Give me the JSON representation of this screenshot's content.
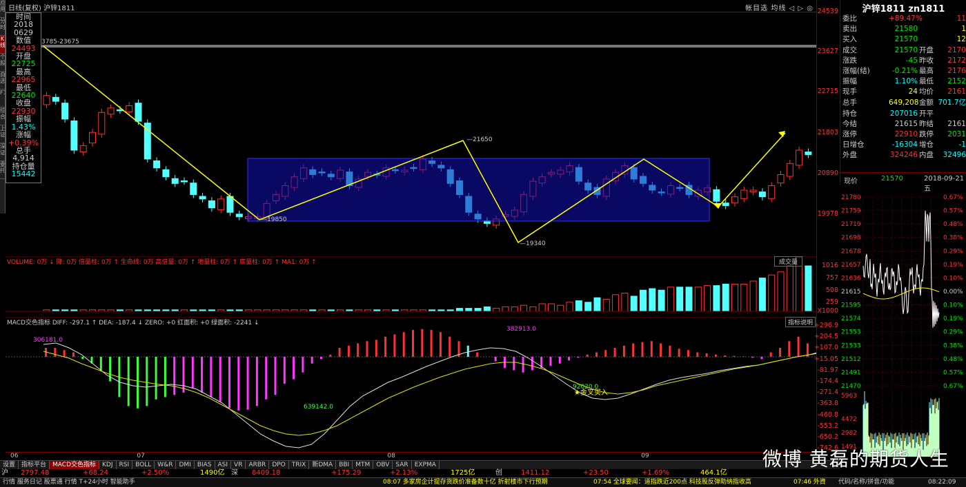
{
  "window": {
    "title_left": "日线(复权)  沪锌1811",
    "title_right": "帐目选 均线 ◁ ▷ ◎"
  },
  "left_tabs": [
    "应用",
    "分时",
    "K线",
    "个股",
    "自选",
    "F10",
    "综合",
    "上证",
    "深证",
    "委托"
  ],
  "info": {
    "time_label": "时间",
    "year": "2018",
    "date": "0629",
    "value_label": "数值",
    "value": "24493",
    "open_label": "开盘",
    "open": "22725",
    "high_label": "最高",
    "high": "22965",
    "low_label": "最低",
    "low": "22640",
    "close_label": "收盘",
    "close": "22930",
    "amp_label": "振幅",
    "amp": "1.43%",
    "chg_label": "涨幅",
    "chg": "+0.39%",
    "vol_label": "总手",
    "vol": "4,914",
    "oi_label": "持仓量",
    "oi": "15442"
  },
  "annotations": {
    "top_range": "3785-23675",
    "p_21650": "21650",
    "p_19850": "19850",
    "p_19340": "19340",
    "macd_306181": "306181.0",
    "macd_382913": "382913.0",
    "macd_639142": "639142.0",
    "macd_92020": "92020.0",
    "golden_cross": "★金叉买入"
  },
  "price_axis": [
    "24539",
    "23627",
    "22715",
    "21803",
    "20890",
    "19978"
  ],
  "vol_legend": {
    "text": "VOLUME: 0万 ↓ 降: 0万 倍量柱: 0万 ↑ 生命线: 0万 高倍量: 0万 ↑ 地量柱: 0万 ↑ 底量柱: 0万 ↑ MA1: 0万 ↑",
    "button": "成交量"
  },
  "vol_axis": [
    "1016",
    "757",
    "508",
    "259",
    "X1000"
  ],
  "macd_legend": {
    "text": "MACD交色指标  DIFF: -297.1 ↑ DEA: -187.4 ↓ ZERO: +0 红面积: +0 绿面积: -2241 ↓",
    "button": "指标说明"
  },
  "macd_axis": [
    "+296.9",
    "+204.5",
    "+107.0",
    "+15.05",
    "-81.97",
    "-174.4",
    "-271.4",
    "-363.8",
    "-460.8",
    "-553.2",
    "-650.2",
    "-742.6"
  ],
  "x_axis": [
    {
      "label": "06",
      "pos": 0.006
    },
    {
      "label": "07",
      "pos": 0.162
    },
    {
      "label": "08",
      "pos": 0.471
    },
    {
      "label": "09",
      "pos": 0.784
    }
  ],
  "bottom_tabs": [
    "设置",
    "指标平台",
    "MACD交色指标",
    "KDJ",
    "RSI",
    "BOLL",
    "W&R",
    "DMI",
    "BIAS",
    "ASI",
    "VR",
    "ARBR",
    "DPO",
    "TRIX",
    "新DMA",
    "BBI",
    "MTM",
    "OBV",
    "SAR",
    "EXPMA"
  ],
  "ticker": [
    {
      "t": "沪",
      "c": "#ccc"
    },
    {
      "t": "2797.48",
      "c": "#ff3232"
    },
    {
      "t": "+68.24",
      "c": "#ff3232"
    },
    {
      "t": "+2.50%",
      "c": "#ff3232"
    },
    {
      "t": "1490亿",
      "c": "#ffff00"
    },
    {
      "t": "深",
      "c": "#ccc"
    },
    {
      "t": "8409.18",
      "c": "#ff3232"
    },
    {
      "t": "+175.29",
      "c": "#ff3232"
    },
    {
      "t": "+2.13%",
      "c": "#ff3232"
    },
    {
      "t": "1725亿",
      "c": "#ffff00"
    },
    {
      "t": "创",
      "c": "#ccc"
    },
    {
      "t": "1411.12",
      "c": "#ff3232"
    },
    {
      "t": "+23.50",
      "c": "#ff3232"
    },
    {
      "t": "+1.69%",
      "c": "#ff3232"
    },
    {
      "t": "464.1亿",
      "c": "#ffff00"
    }
  ],
  "status_bar": {
    "left": "行情  服务日记  股票通  行情  T+24小时  智能助手",
    "news1": "08:07 多家房企计提存货跌价准备数十亿 折射楼市下行预期",
    "news2": "07:54 全球要闻：道指跌近200点 科技股反弹助纳指收高",
    "news3": "07:46 外資",
    "right": "代码/名称/拼音/功能",
    "clock": "08:22:09"
  },
  "panel": {
    "title": "沪锌1811 zn1811",
    "rows": [
      {
        "l": "委比",
        "v": "+89.47%",
        "vc": "#ff3232",
        "l2": "",
        "v2": "11",
        "v2c": "#ff3232"
      },
      {
        "l": "卖出",
        "v": "21580",
        "vc": "#00e600",
        "l2": "",
        "v2": "1",
        "v2c": "#ffff00"
      },
      {
        "l": "买入",
        "v": "21570",
        "vc": "#00e600",
        "l2": "",
        "v2": "12",
        "v2c": "#ffff00"
      },
      {
        "l": "成交",
        "v": "21570",
        "vc": "#00e600",
        "l2": "开盘",
        "v2": "2170",
        "v2c": "#ff3232"
      },
      {
        "l": "涨跌",
        "v": "-45",
        "vc": "#00e600",
        "l2": "昨收",
        "v2": "2172",
        "v2c": "#ff3232"
      },
      {
        "l": "涨幅(结)",
        "v": "-0.21%",
        "vc": "#00e600",
        "l2": "最高",
        "v2": "2176",
        "v2c": "#ff3232"
      },
      {
        "l": "振幅",
        "v": "1.10%",
        "vc": "#00ffff",
        "l2": "最低",
        "v2": "2152",
        "v2c": "#00e600"
      },
      {
        "l": "现手",
        "v": "24",
        "vc": "#ffff00",
        "l2": "均价",
        "v2": "2161",
        "v2c": "#ff3232"
      },
      {
        "l": "总手",
        "v": "649,208",
        "vc": "#ffff00",
        "l2": "金额",
        "v2": "701.7亿",
        "v2c": "#00ffff"
      },
      {
        "l": "持仓",
        "v": "207016",
        "vc": "#00ffff",
        "l2": "开平",
        "v2": "",
        "v2c": "#ccc"
      },
      {
        "l": "今结",
        "v": "21615",
        "vc": "#ccc",
        "l2": "昨结",
        "v2": "2161",
        "v2c": "#ccc"
      },
      {
        "l": "涨停",
        "v": "22910",
        "vc": "#ff3232",
        "l2": "跌停",
        "v2": "2031",
        "v2c": "#00e600"
      },
      {
        "l": "日增仓",
        "v": "-16304",
        "vc": "#00ffff",
        "l2": "增仓",
        "v2": "-1",
        "v2c": "#00ffff"
      },
      {
        "l": "外盘",
        "v": "324246",
        "vc": "#ff3232",
        "l2": "内盘",
        "v2": "32496",
        "v2c": "#00ffff"
      }
    ]
  },
  "tick": {
    "label": "现价",
    "price": "21570",
    "date": "2018-09-21 五"
  },
  "intraday_axis": [
    "21780",
    "21759",
    "21719",
    "21698",
    "21678",
    "21657",
    "21636",
    "21615",
    "21595",
    "21574",
    "21553",
    "21533",
    "21512",
    "21491",
    "21470",
    "5963",
    "4472",
    "2982",
    "1491"
  ],
  "intraday_pct": [
    "0.67%",
    "0.57%",
    "0.48%",
    "0.38%",
    "0.29%",
    "0.19%",
    "0.10%",
    "0.00%",
    "0.10%",
    "0.19%",
    "0.29%",
    "0.38%",
    "0.48%",
    "0.57%",
    "0.67%"
  ],
  "watermark": "微博 黄磊的期货人生",
  "colors": {
    "up": "#ff3232",
    "down": "#54ffff",
    "ma": "#ffff00",
    "box": "#1010a0"
  }
}
